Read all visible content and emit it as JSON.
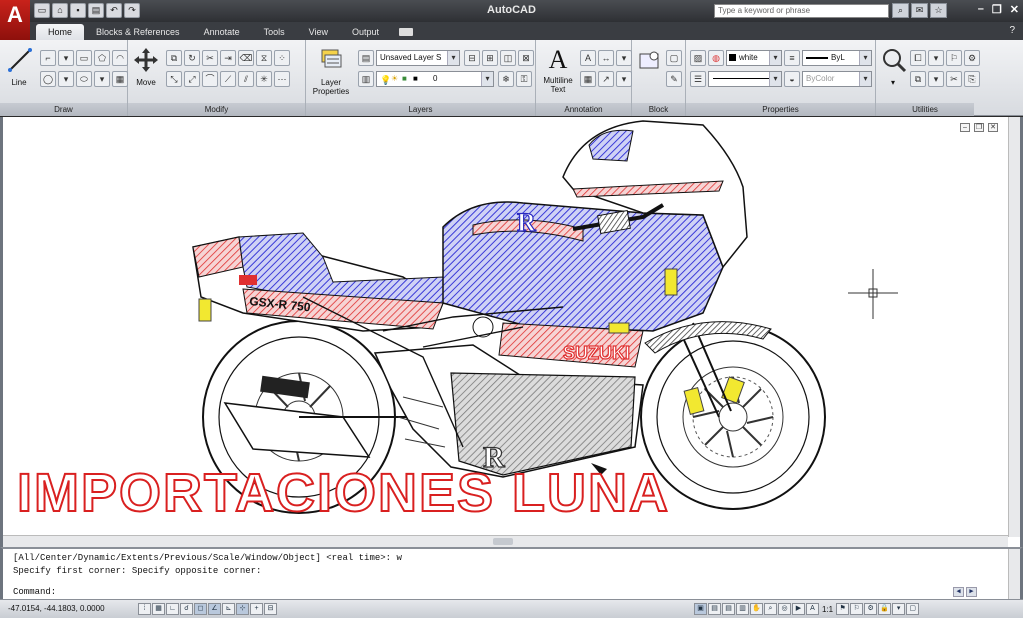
{
  "window": {
    "title": "AutoCAD",
    "logo": "A"
  },
  "search": {
    "placeholder": "Type a keyword or phrase"
  },
  "quick_access": [
    "new-icon",
    "open-icon",
    "save-icon",
    "print-icon",
    "undo-icon",
    "redo-icon"
  ],
  "ribbon_tabs": [
    "Home",
    "Blocks & References",
    "Annotate",
    "Tools",
    "View",
    "Output"
  ],
  "active_tab": "Home",
  "panels": {
    "draw": {
      "title": "Draw",
      "line_label": "Line"
    },
    "modify": {
      "title": "Modify",
      "move_label": "Move"
    },
    "layers": {
      "title": "Layers",
      "layer_properties_label": "Layer Properties",
      "layer_combo": "Unsaved Layer S",
      "layer_state": "0"
    },
    "annotation": {
      "title": "Annotation",
      "mtext_label": "Multiline Text"
    },
    "block": {
      "title": "Block"
    },
    "properties": {
      "title": "Properties",
      "color": "white",
      "lineweight": "ByL",
      "plotstyle": "ByColor"
    },
    "utilities": {
      "title": "Utilities"
    }
  },
  "drawing": {
    "watermark": "IMPORTACIONES LUNA",
    "decal_text": "SUZUKI",
    "tank_letter": "R",
    "colors": {
      "blue_hatch": "#3a3ad8",
      "red_hatch": "#e03030",
      "gray_hatch": "#7a7a7a",
      "yellow": "#f2e830"
    }
  },
  "command": {
    "line1": "[All/Center/Dynamic/Extents/Previous/Scale/Window/Object] <real time>: w",
    "line2": "Specify first corner: Specify opposite corner:",
    "prompt": "Command:"
  },
  "status": {
    "coords": "-47.0154, -44.1803, 0.0000",
    "annotation_scale": "1:1"
  }
}
